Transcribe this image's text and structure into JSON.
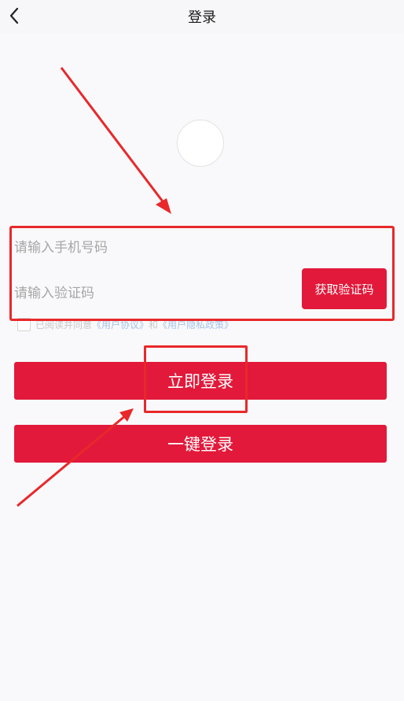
{
  "nav": {
    "title": "登录",
    "back_icon": "back-chevron-icon"
  },
  "form": {
    "phone_placeholder": "请输入手机号码",
    "code_placeholder": "请输入验证码",
    "get_code_label": "获取验证码"
  },
  "agreement": {
    "prefix": "已阅读并同意",
    "user_agreement": "《用户协议》",
    "connector": "和",
    "privacy_policy": "《用户隐私政策》"
  },
  "buttons": {
    "login_now": "立即登录",
    "one_key_login": "一键登录"
  },
  "colors": {
    "primary": "#e2193a",
    "annotation": "#e8282b",
    "link": "#a6c4e6"
  }
}
